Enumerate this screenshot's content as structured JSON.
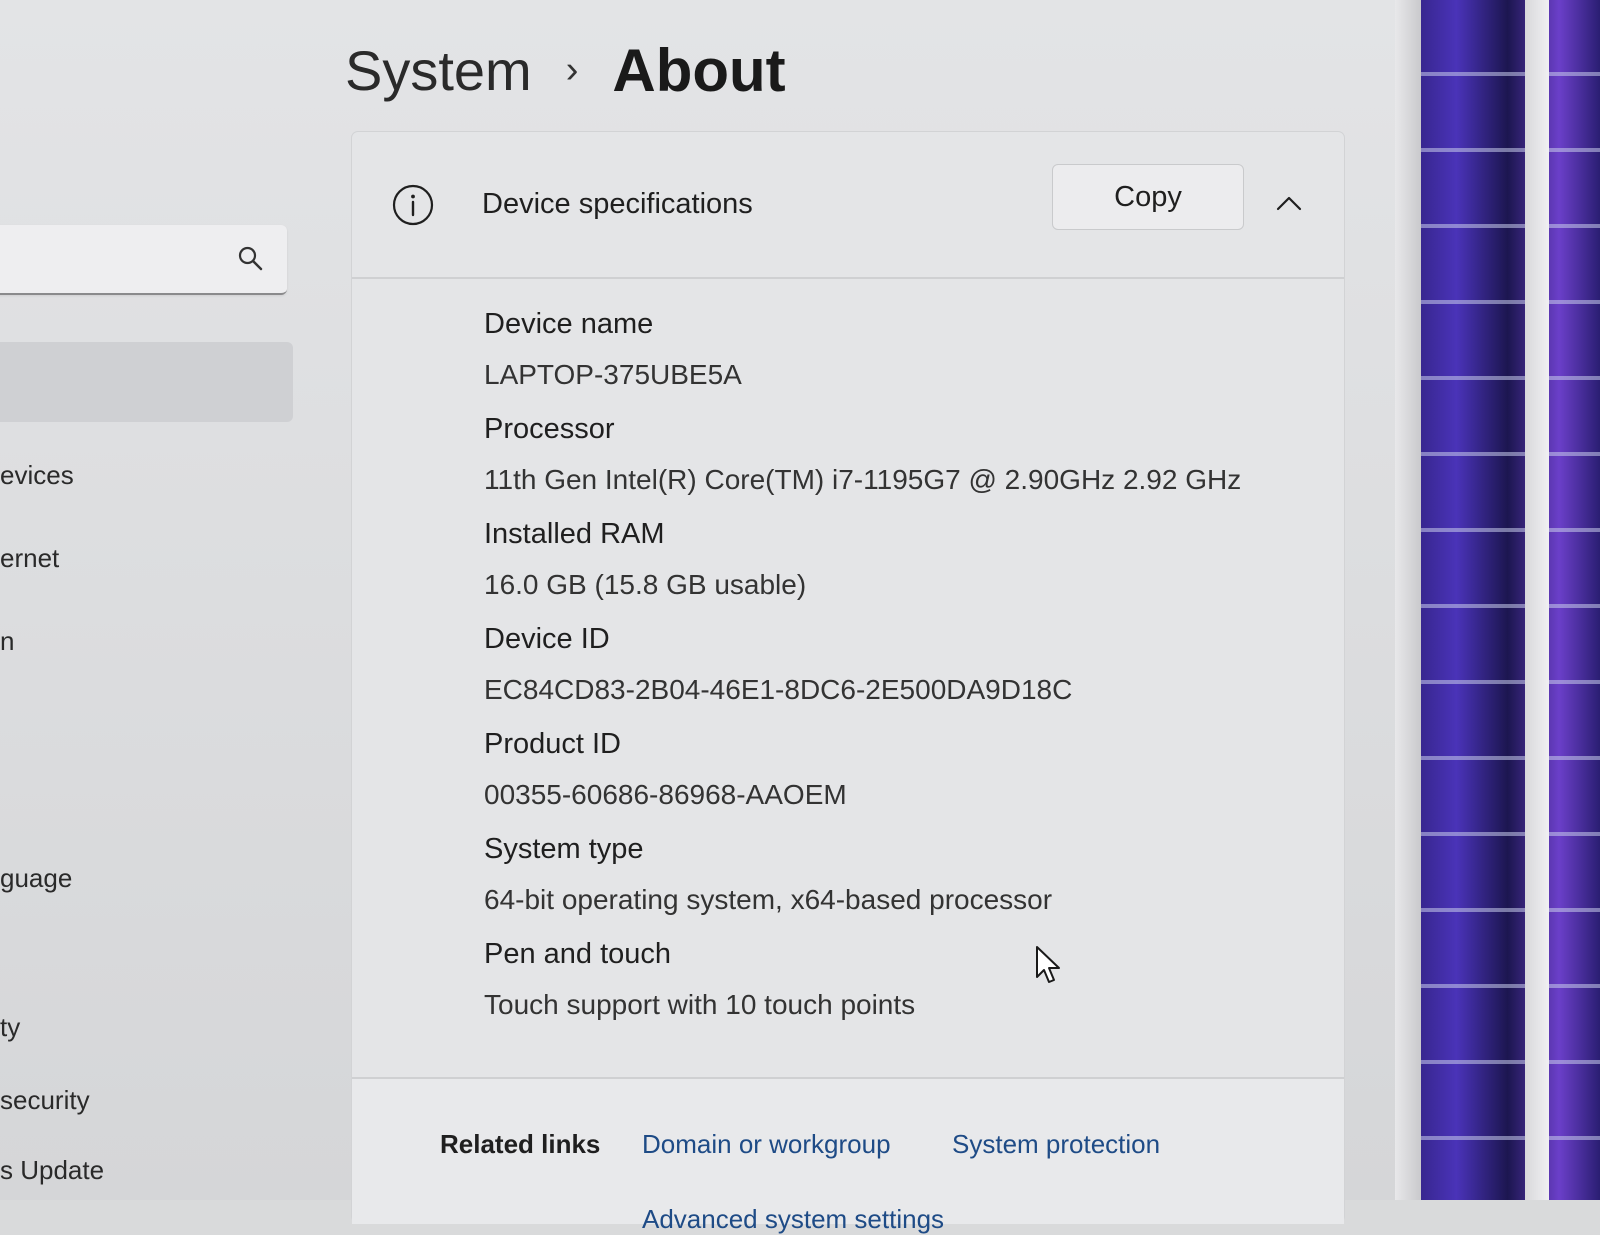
{
  "breadcrumb": {
    "parent": "System",
    "separator": "›",
    "current": "About"
  },
  "sidebar": {
    "search_icon": "search-icon",
    "items": [
      {
        "label": "evices",
        "selected": false
      },
      {
        "label": "ernet",
        "selected": false
      },
      {
        "label": "n",
        "selected": false
      },
      {
        "label": "guage",
        "selected": false
      },
      {
        "label": "ty",
        "selected": false
      },
      {
        "label": "security",
        "selected": false
      },
      {
        "label": "s Update",
        "selected": false
      }
    ]
  },
  "device_specs": {
    "title": "Device specifications",
    "info_icon": "info-icon",
    "copy_label": "Copy",
    "collapse_icon": "chevron-up-icon",
    "items": [
      {
        "label": "Device name",
        "value": "LAPTOP-375UBE5A"
      },
      {
        "label": "Processor",
        "value": "11th Gen Intel(R) Core(TM) i7-1195G7 @ 2.90GHz   2.92 GHz"
      },
      {
        "label": "Installed RAM",
        "value": "16.0 GB (15.8 GB usable)"
      },
      {
        "label": "Device ID",
        "value": "EC84CD83-2B04-46E1-8DC6-2E500DA9D18C"
      },
      {
        "label": "Product ID",
        "value": "00355-60686-86968-AAOEM"
      },
      {
        "label": "System type",
        "value": "64-bit operating system, x64-based processor"
      },
      {
        "label": "Pen and touch",
        "value": "Touch support with 10 touch points"
      }
    ]
  },
  "related": {
    "label": "Related links",
    "links": [
      "Domain or workgroup",
      "System protection",
      "Advanced system settings"
    ]
  },
  "colors": {
    "link": "#1e4b86",
    "card_background": "#e4e5e7",
    "selected_nav": "#cfd0d3"
  }
}
